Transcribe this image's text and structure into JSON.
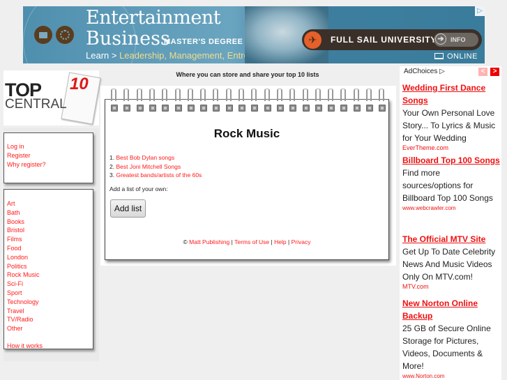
{
  "banner": {
    "title_line1": "Entertainment",
    "title_line2": "Business",
    "degree": "MASTER'S DEGREE",
    "learn_prefix": "Learn >",
    "learn_topics": "Leadership, Management, Entrepreneurship",
    "university": "FULL SAIL UNIVERSITY.",
    "info_label": "INFO",
    "online_label": "ONLINE",
    "adchoices_glyph": "▷",
    "plane_glyph": "✈",
    "arrow_glyph": "➔"
  },
  "logo": {
    "top": "TOP",
    "central": "CENTRAL",
    "ten": "10"
  },
  "auth_links": [
    "Log in",
    "Register",
    "Why register?"
  ],
  "categories": [
    "Art",
    "Bath",
    "Books",
    "Bristol",
    "Films",
    "Food",
    "London",
    "Politics",
    "Rock Music",
    "Sci-Fi",
    "Sport",
    "Technology",
    "Travel",
    "TV/Radio",
    "Other"
  ],
  "how_it_works": "How it works",
  "tagline": "Where you can store and share your top 10 lists",
  "main": {
    "title": "Rock Music",
    "lists": [
      {
        "num": "1.",
        "label": "Best Bob Dylan songs"
      },
      {
        "num": "2.",
        "label": "Best Joni Mitchell Songs"
      },
      {
        "num": "3.",
        "label": "Greatest bands/artists of the 60s"
      }
    ],
    "add_own_label": "Add a list of your own:",
    "add_button": "Add list"
  },
  "footer": {
    "copyright": "©",
    "links": [
      "Matt Publishing",
      "Terms of Use",
      "Help",
      "Privacy"
    ],
    "separator": "|"
  },
  "ads": {
    "adchoices": "AdChoices ▷",
    "prev": "<",
    "next": ">",
    "items": [
      {
        "title": "Wedding First Dance Songs",
        "body": "Your Own Personal Love Story... To Lyrics & Music for Your Wedding",
        "url": "EverTheme.com"
      },
      {
        "title": "Billboard Top 100 Songs",
        "body": "Find more sources/options for Billboard Top 100 Songs",
        "url": "www.webcrawler.com"
      },
      {
        "title": "The Official MTV Site",
        "body": "Get Up To Date Celebrity News And Music Videos Only On MTV.com!",
        "url": "MTV.com"
      },
      {
        "title": "New Norton Online Backup",
        "body": "25 GB of Secure Online Storage for Pictures, Videos, Documents & More!",
        "url": "www.Norton.com"
      }
    ]
  },
  "colors": {
    "link": "#ff1a1a",
    "ad_nav_active": "#ee0000",
    "ad_nav_inactive": "#ffb3b3",
    "page_bg": "#efefef"
  }
}
